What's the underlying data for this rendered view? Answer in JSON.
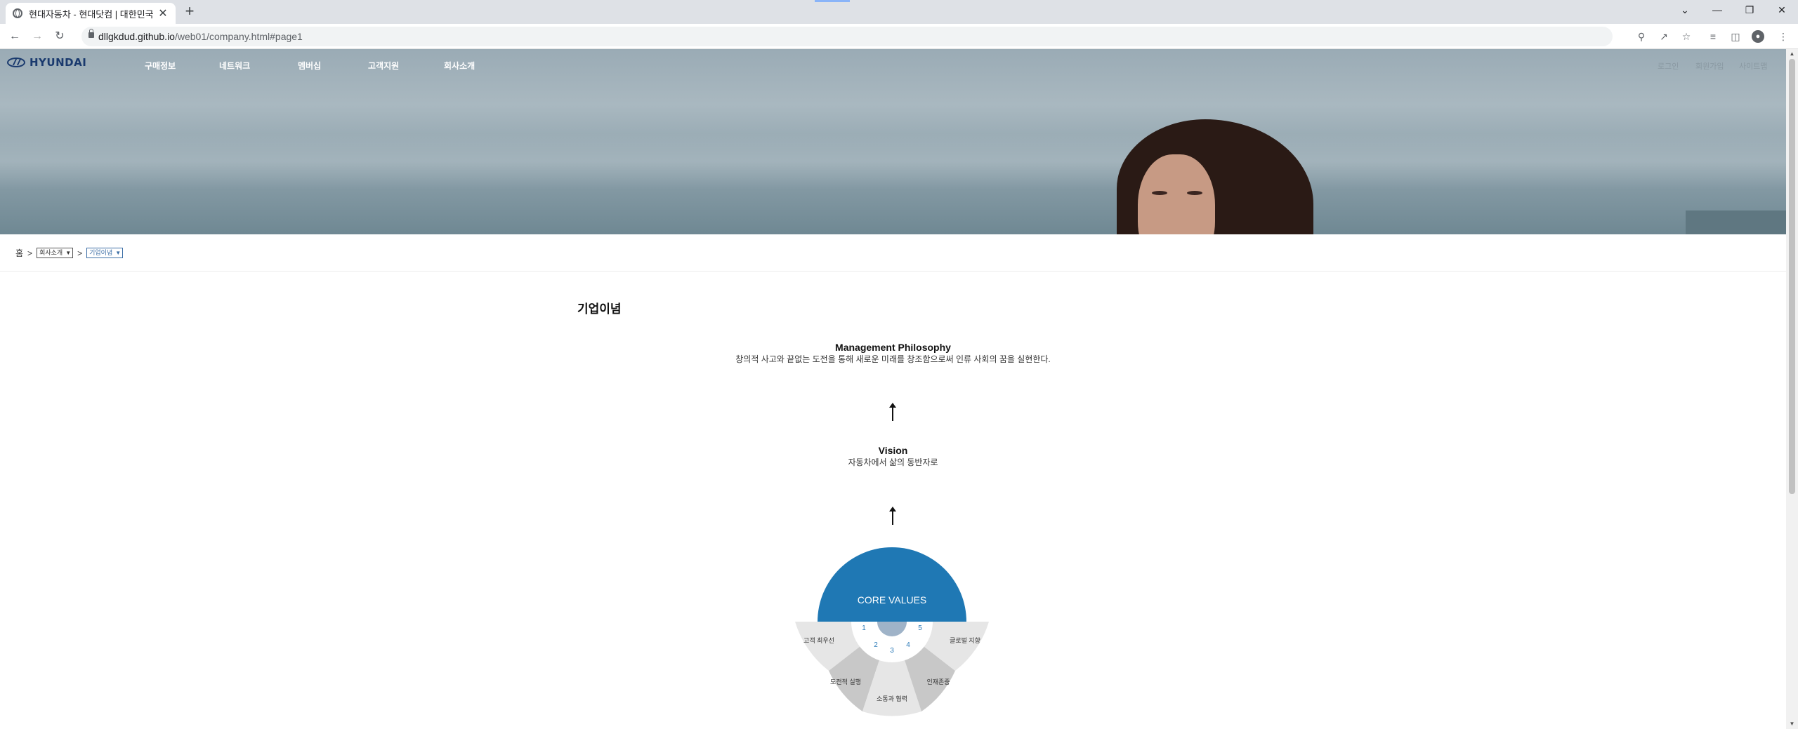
{
  "browser": {
    "tab_title": "현대자동차 - 현대닷컴 | 대한민국",
    "tab_close": "✕",
    "new_tab": "+",
    "url_host": "dllgkdud.github.io",
    "url_path": "/web01/company.html#page1",
    "controls": {
      "minimize": "—",
      "restore": "❐",
      "close": "✕",
      "tab_menu": "⌄"
    }
  },
  "header": {
    "logo": "HYUNDAI",
    "nav": [
      "구매정보",
      "네트워크",
      "멤버십",
      "고객지원",
      "회사소개"
    ],
    "util": [
      "로그인",
      "회원가입",
      "사이트맵"
    ]
  },
  "breadcrumb": {
    "home": "홈",
    "sep": ">",
    "select1": "회사소개",
    "select2": "기업이념"
  },
  "content": {
    "title": "기업이념",
    "philosophy": {
      "heading": "Management Philosophy",
      "text": "창의적 사고와 끝없는 도전을 통해 새로운 미래를 창조함으로써 인류 사회의 꿈을 실현한다."
    },
    "vision": {
      "heading": "Vision",
      "text": "자동차에서 삶의 동반자로"
    },
    "core_values": {
      "title": "CORE VALUES",
      "items": [
        {
          "num": "1",
          "label": "고객 최우선"
        },
        {
          "num": "2",
          "label": "도전적 실행"
        },
        {
          "num": "3",
          "label": "소통과 협력"
        },
        {
          "num": "4",
          "label": "인재존중"
        },
        {
          "num": "5",
          "label": "글로벌 지향"
        }
      ],
      "colors": {
        "core": "#1f78b4",
        "hub": "#9fb3c8",
        "segment_light": "#e6e6e6",
        "segment_dark": "#c8c8c8",
        "number": "#2b7ab8"
      }
    }
  }
}
